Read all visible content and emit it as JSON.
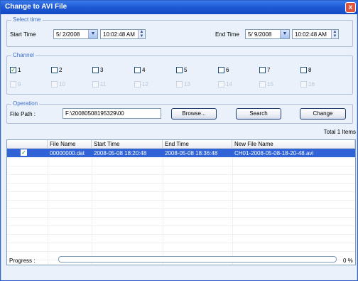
{
  "window": {
    "title": "Change to AVI File",
    "close_glyph": "x"
  },
  "select_time": {
    "group_title": "Select time",
    "start_label": "Start Time",
    "start_date": "5/ 2/2008",
    "start_time": "10:02:48 AM",
    "end_label": "End Time",
    "end_date": "5/ 9/2008",
    "end_time": "10:02:48 AM"
  },
  "channel": {
    "group_title": "Channel",
    "checkmark": "✓",
    "row1": [
      {
        "label": "1",
        "checked": true
      },
      {
        "label": "2",
        "checked": false
      },
      {
        "label": "3",
        "checked": false
      },
      {
        "label": "4",
        "checked": false
      },
      {
        "label": "5",
        "checked": false
      },
      {
        "label": "6",
        "checked": false
      },
      {
        "label": "7",
        "checked": false
      },
      {
        "label": "8",
        "checked": false
      }
    ],
    "row2": [
      "9",
      "10",
      "11",
      "12",
      "13",
      "14",
      "15",
      "16"
    ]
  },
  "operation": {
    "group_title": "Operation",
    "file_path_label": "File Path :",
    "file_path_value": "F:\\20080508195329\\00",
    "browse_label": "Browse...",
    "search_label": "Search",
    "change_label": "Change"
  },
  "results": {
    "total_label": "Total 1 Items",
    "columns": [
      "File Name",
      "Start Time",
      "End Time",
      "New File Name"
    ],
    "rows": [
      {
        "checked": true,
        "file_name": "00000000.dat",
        "start_time": "2008-05-08 18:20:48",
        "end_time": "2008-05-08 18:36:48",
        "new_file_name": "CH01-2008-05-08-18-20-48.avi"
      }
    ]
  },
  "progress": {
    "label": "Progress :",
    "percent_text": "0 %",
    "value": 0
  },
  "colors": {
    "titlebar": "#1f5bd6",
    "selection": "#2f63d6",
    "group_title": "#3b6ec8"
  }
}
